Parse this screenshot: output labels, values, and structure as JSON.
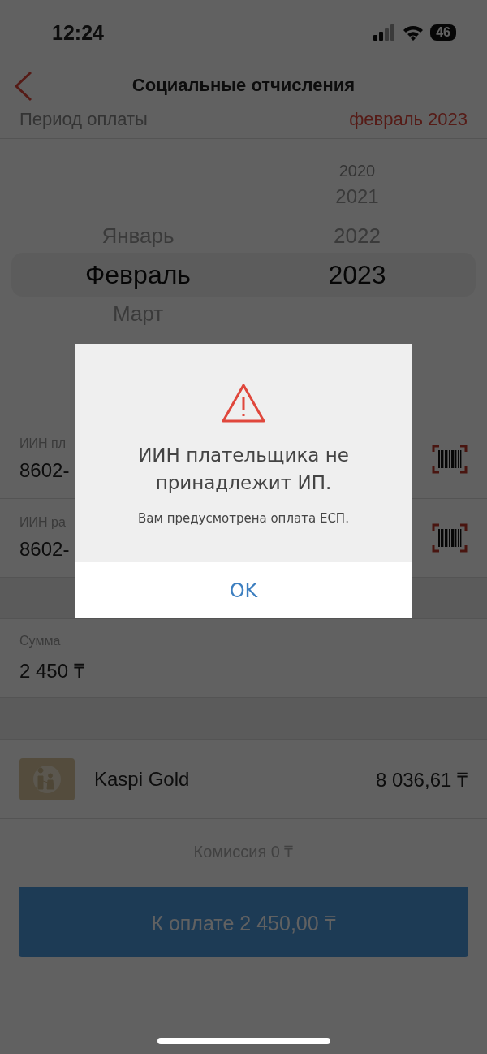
{
  "status_bar": {
    "time": "12:24",
    "battery": "46"
  },
  "header": {
    "title": "Социальные отчисления"
  },
  "period": {
    "label": "Период оплаты",
    "value": "февраль 2023"
  },
  "picker": {
    "months": [
      {
        "label": "Январь",
        "selected": false
      },
      {
        "label": "Февраль",
        "selected": true
      },
      {
        "label": "Март",
        "selected": false
      }
    ],
    "years": [
      {
        "label": "2020",
        "selected": false
      },
      {
        "label": "2021",
        "selected": false
      },
      {
        "label": "2022",
        "selected": false
      },
      {
        "label": "2023",
        "selected": true
      }
    ]
  },
  "fields": [
    {
      "kind": "scan",
      "label": "ИИН пл",
      "value": "8602-"
    },
    {
      "kind": "scan",
      "label": "ИИН ра",
      "value": "8602-"
    },
    {
      "kind": "plain",
      "label": "Сумма",
      "value": "2 450 ₸"
    }
  ],
  "payment_source": {
    "name": "Kaspi Gold",
    "balance": "8 036,61 ₸"
  },
  "commission": "Комиссия 0 ₸",
  "pay_button": {
    "label": "К оплате 2 450,00 ₸"
  },
  "dialog": {
    "title": "ИИН плательщика не принадлежит ИП.",
    "message": "Вам предусмотрена оплата ЕСП.",
    "button": "OK"
  }
}
